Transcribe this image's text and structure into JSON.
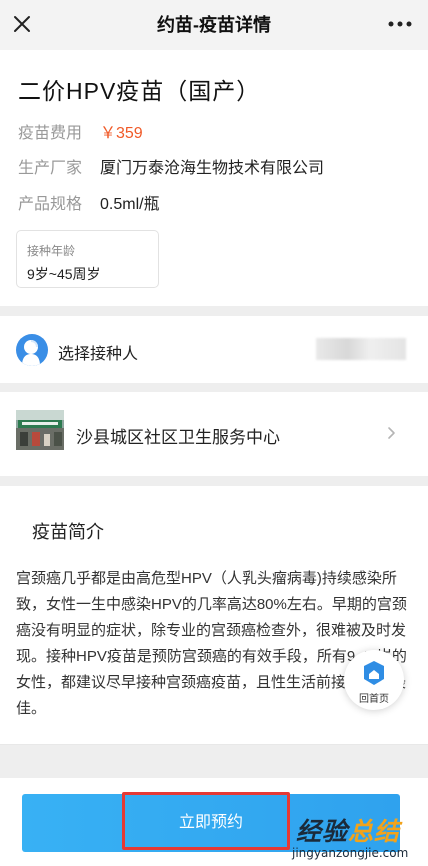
{
  "navbar": {
    "title": "约苗-疫苗详情",
    "close_icon": "close-icon",
    "more_icon": "more-icon"
  },
  "vaccine": {
    "name": "二价HPV疫苗（国产）",
    "fee_label": "疫苗费用",
    "fee_value": "￥359",
    "manufacturer_label": "生产厂家",
    "manufacturer_value": "厦门万泰沧海生物技术有限公司",
    "spec_label": "产品规格",
    "spec_value": "0.5ml/瓶",
    "age_label": "接种年龄",
    "age_value": "9岁~45周岁",
    "price_color": "#f05a28"
  },
  "recipient": {
    "label": "选择接种人",
    "icon": "user-avatar-icon",
    "accent_color": "#3a8ee6"
  },
  "clinic": {
    "name": "沙县城区社区卫生服务中心",
    "icon": "chevron-right-icon"
  },
  "intro": {
    "title": "疫苗简介",
    "body": "宫颈癌几乎都是由高危型HPV（人乳头瘤病毒)持续感染所致，女性一生中感染HPV的几率高达80%左右。早期的宫颈癌没有明显的症状，除专业的宫颈癌检查外，很难被及时发现。接种HPV疫苗是预防宫颈癌的有效手段，所有9-45岁的女性，都建议尽早接种宫颈癌疫苗，且性生活前接种效果最佳。"
  },
  "home_fab": {
    "label": "回首页",
    "icon": "home-icon"
  },
  "footer": {
    "book_label": "立即预约",
    "button_color": "#2fa2ee",
    "highlight_color": "#e53935"
  },
  "watermark": {
    "main_prefix": "经验",
    "main_accent": "总结",
    "sub": "jingyanzongjie.com"
  }
}
